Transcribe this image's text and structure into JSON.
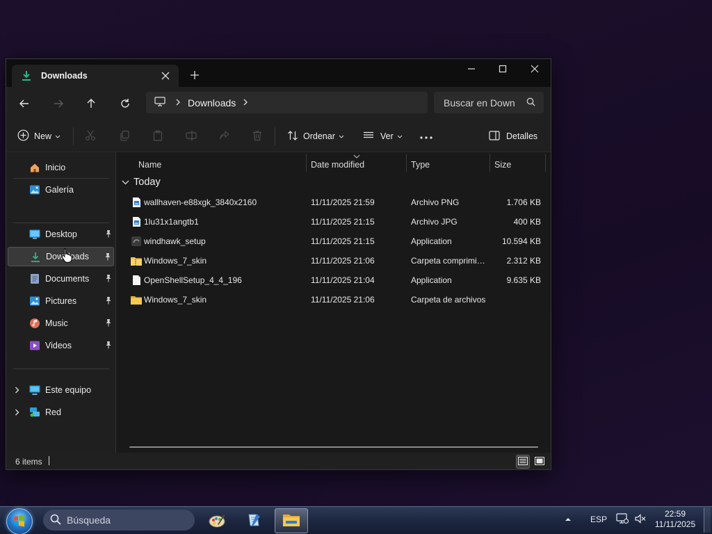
{
  "window": {
    "tab_title": "Downloads",
    "tab_icon": "download-arrow-icon",
    "accent_color": "#2fb38a"
  },
  "address_bar": {
    "breadcrumb": [
      "Downloads"
    ],
    "search_placeholder": "Buscar en Down"
  },
  "command_bar": {
    "new_label": "New",
    "sort_label": "Ordenar",
    "view_label": "Ver",
    "details_label": "Detalles"
  },
  "sidebar": {
    "items": [
      {
        "label": "Inicio",
        "icon": "home-icon"
      },
      {
        "label": "Galería",
        "icon": "gallery-icon"
      },
      {
        "label": "Desktop",
        "icon": "desktop-folder-icon"
      },
      {
        "label": "Downloads",
        "icon": "downloads-folder-icon"
      },
      {
        "label": "Documents",
        "icon": "documents-folder-icon"
      },
      {
        "label": "Pictures",
        "icon": "pictures-folder-icon"
      },
      {
        "label": "Music",
        "icon": "music-folder-icon"
      },
      {
        "label": "Videos",
        "icon": "videos-folder-icon"
      },
      {
        "label": "Este equipo",
        "icon": "this-pc-icon"
      },
      {
        "label": "Red",
        "icon": "network-icon"
      }
    ],
    "selected": "Downloads"
  },
  "columns": {
    "name": "Name",
    "date": "Date modified",
    "type": "Type",
    "size": "Size"
  },
  "group_label": "Today",
  "files": [
    {
      "name": "wallhaven-e88xgk_3840x2160",
      "date": "11/11/2025 21:59",
      "type": "Archivo PNG",
      "size": "1.706 KB",
      "icon": "image-file-icon"
    },
    {
      "name": "1lu31x1angtb1",
      "date": "11/11/2025 21:15",
      "type": "Archivo JPG",
      "size": "400 KB",
      "icon": "image-file-icon"
    },
    {
      "name": "windhawk_setup",
      "date": "11/11/2025 21:15",
      "type": "Application",
      "size": "10.594 KB",
      "icon": "application-icon"
    },
    {
      "name": "Windows_7_skin",
      "date": "11/11/2025 21:06",
      "type": "Carpeta comprimida (zip)",
      "size": "2.312 KB",
      "icon": "zip-folder-icon"
    },
    {
      "name": "OpenShellSetup_4_4_196",
      "date": "11/11/2025 21:04",
      "type": "Application",
      "size": "9.635 KB",
      "icon": "blank-file-icon"
    },
    {
      "name": "Windows_7_skin",
      "date": "11/11/2025 21:06",
      "type": "Carpeta de archivos",
      "size": "",
      "icon": "folder-icon"
    }
  ],
  "status_bar": {
    "item_count": "6 items"
  },
  "taskbar": {
    "search_placeholder": "Búsqueda",
    "language": "ESP",
    "time": "22:59",
    "date": "11/11/2025"
  }
}
